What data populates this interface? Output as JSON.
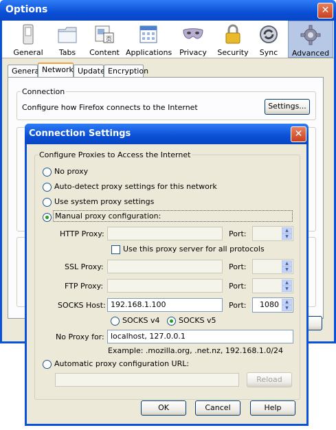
{
  "options_window": {
    "title": "Options",
    "close_symbol": "✕",
    "toolbar": [
      {
        "label": "General",
        "icon": "switch-icon"
      },
      {
        "label": "Tabs",
        "icon": "folder-tabs-icon"
      },
      {
        "label": "Content",
        "icon": "content-icon"
      },
      {
        "label": "Applications",
        "icon": "applications-icon"
      },
      {
        "label": "Privacy",
        "icon": "mask-icon"
      },
      {
        "label": "Security",
        "icon": "padlock-icon"
      },
      {
        "label": "Sync",
        "icon": "sync-icon"
      },
      {
        "label": "Advanced",
        "icon": "gear-icon"
      }
    ],
    "tabs": [
      "General",
      "Network",
      "Update",
      "Encryption"
    ],
    "connection": {
      "heading": "Connection",
      "description": "Configure how Firefox connects to the Internet",
      "settings_button": "Settings..."
    }
  },
  "connection_dialog": {
    "title": "Connection Settings",
    "close_symbol": "✕",
    "group_title": "Configure Proxies to Access the Internet",
    "options": {
      "no_proxy": "No proxy",
      "auto_detect": "Auto-detect proxy settings for this network",
      "system": "Use system proxy settings",
      "manual": "Manual proxy configuration:"
    },
    "http_label": "HTTP Proxy:",
    "http_value": "",
    "port_label": "Port:",
    "same_proxy_label": "Use this proxy server for all protocols",
    "ssl_label": "SSL Proxy:",
    "ssl_value": "",
    "ftp_label": "FTP Proxy:",
    "ftp_value": "",
    "socks_label": "SOCKS Host:",
    "socks_value": "192.168.1.100",
    "socks_port": "1080",
    "socks_v4": "SOCKS v4",
    "socks_v5": "SOCKS v5",
    "no_proxy_label": "No Proxy for:",
    "no_proxy_value": "localhost, 127.0.0.1",
    "example": "Example: .mozilla.org, .net.nz, 192.168.1.0/24",
    "auto_url_label": "Automatic proxy configuration URL:",
    "auto_url_value": "",
    "reload_button": "Reload",
    "ok_button": "OK",
    "cancel_button": "Cancel",
    "help_button": "Help",
    "colors": {
      "titlebar": "#0a53d8",
      "face": "#ece9d8",
      "focus_radio": "#21a121"
    }
  }
}
